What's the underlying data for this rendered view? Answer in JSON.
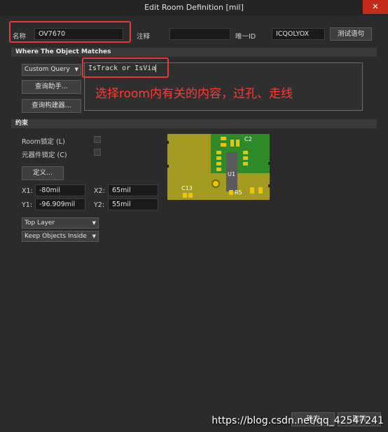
{
  "window": {
    "title": "Edit Room Definition [mil]",
    "close_glyph": "✕"
  },
  "header": {
    "name_label": "名称",
    "name_value": "OV7670",
    "comment_label": "注释",
    "comment_value": "",
    "unique_id_label": "唯一ID",
    "unique_id_value": "ICQOLYOX",
    "test_button": "测试语句"
  },
  "where": {
    "section_title": "Where The Object Matches",
    "query_type": "Custom Query",
    "query_text": "IsTrack or IsVia",
    "annotation": "选择room内有关的内容，过孔、走线",
    "query_helper_button": "查询助手...",
    "query_builder_button": "查询构建器..."
  },
  "constraints": {
    "section_title": "约束",
    "room_lock_label": "Room锁定 (L)",
    "component_lock_label": "元器件锁定 (C)",
    "define_button": "定义...",
    "x1_label": "X1:",
    "x1_value": "-80mil",
    "x2_label": "X2:",
    "x2_value": "65mil",
    "y1_label": "Y1:",
    "y1_value": "-96.909mil",
    "y2_label": "Y2:",
    "y2_value": "55mil",
    "layer": "Top Layer",
    "keep_mode": "Keep Objects Inside",
    "preview_labels": {
      "c2": "C2",
      "u1": "U1",
      "c13": "C13",
      "r5": "R5"
    }
  },
  "footer": {
    "ok_button": "确定",
    "cancel_button": "取消",
    "watermark": "https://blog.csdn.net/qq_42547241"
  },
  "colors": {
    "annotation_red": "#ff3b30",
    "pcb_green": "#2e8b27",
    "pad_yellow": "#f2c200"
  }
}
